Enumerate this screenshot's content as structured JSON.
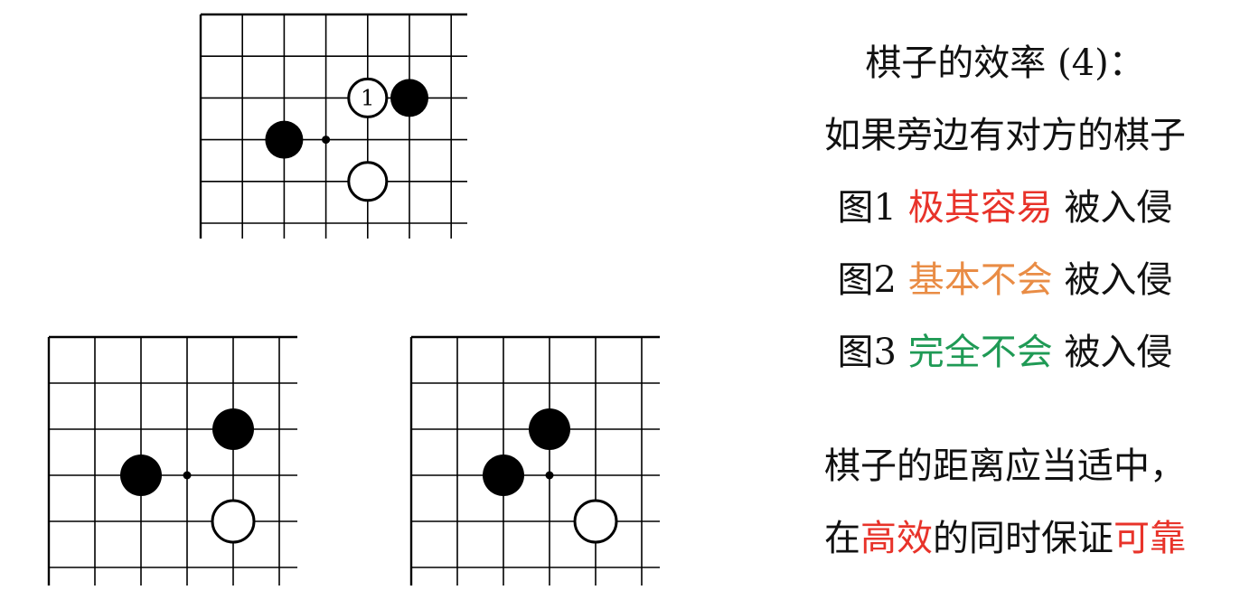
{
  "boards": [
    {
      "name": "figure-1",
      "stones": [
        {
          "color": "black",
          "col": 5,
          "row": 2,
          "label": ""
        },
        {
          "color": "white",
          "col": 4,
          "row": 2,
          "label": "1"
        },
        {
          "color": "black",
          "col": 2,
          "row": 3,
          "label": ""
        },
        {
          "color": "white",
          "col": 4,
          "row": 4,
          "label": ""
        }
      ],
      "star_points": [
        {
          "col": 3,
          "row": 3
        }
      ]
    },
    {
      "name": "figure-2",
      "stones": [
        {
          "color": "black",
          "col": 4,
          "row": 2,
          "label": ""
        },
        {
          "color": "black",
          "col": 2,
          "row": 3,
          "label": ""
        },
        {
          "color": "white",
          "col": 4,
          "row": 4,
          "label": ""
        }
      ],
      "star_points": [
        {
          "col": 3,
          "row": 3
        }
      ]
    },
    {
      "name": "figure-3",
      "stones": [
        {
          "color": "black",
          "col": 3,
          "row": 2,
          "label": ""
        },
        {
          "color": "black",
          "col": 2,
          "row": 3,
          "label": ""
        },
        {
          "color": "white",
          "col": 4,
          "row": 4,
          "label": ""
        }
      ],
      "star_points": [
        {
          "col": 3,
          "row": 3
        }
      ]
    }
  ],
  "text": {
    "title": "棋子的效率 (4)：",
    "subtitle": "如果旁边有对方的棋子",
    "fig1": {
      "label": "图1",
      "highlight": "极其容易",
      "tail": "被入侵"
    },
    "fig2": {
      "label": "图2",
      "highlight": "基本不会",
      "tail": "被入侵"
    },
    "fig3": {
      "label": "图3",
      "highlight": "完全不会",
      "tail": "被入侵"
    },
    "conclusion_1": "棋子的距离应当适中，",
    "conclusion_2": {
      "a": "在",
      "b": "高效",
      "c": "的同时保证",
      "d": "可靠"
    }
  },
  "colors": {
    "red": "#e8332a",
    "orange": "#e98c45",
    "green": "#1f9a55"
  }
}
